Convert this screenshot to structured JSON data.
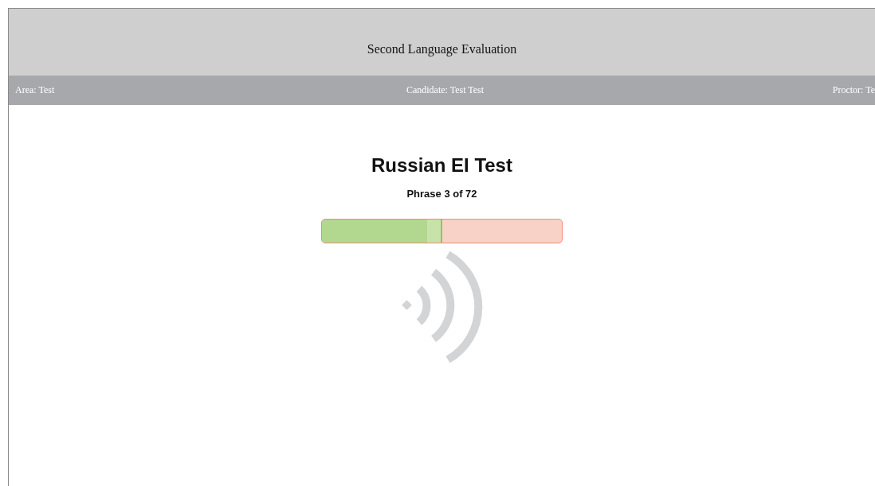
{
  "header": {
    "title": "Second Language Evaluation"
  },
  "info_bar": {
    "area": "Area: Test",
    "candidate": "Candidate: Test Test",
    "proctor": "Proctor: Te"
  },
  "test": {
    "title": "Russian EI Test",
    "phrase": "Phrase 3 of 72"
  },
  "progress": {
    "level": 0.5
  }
}
